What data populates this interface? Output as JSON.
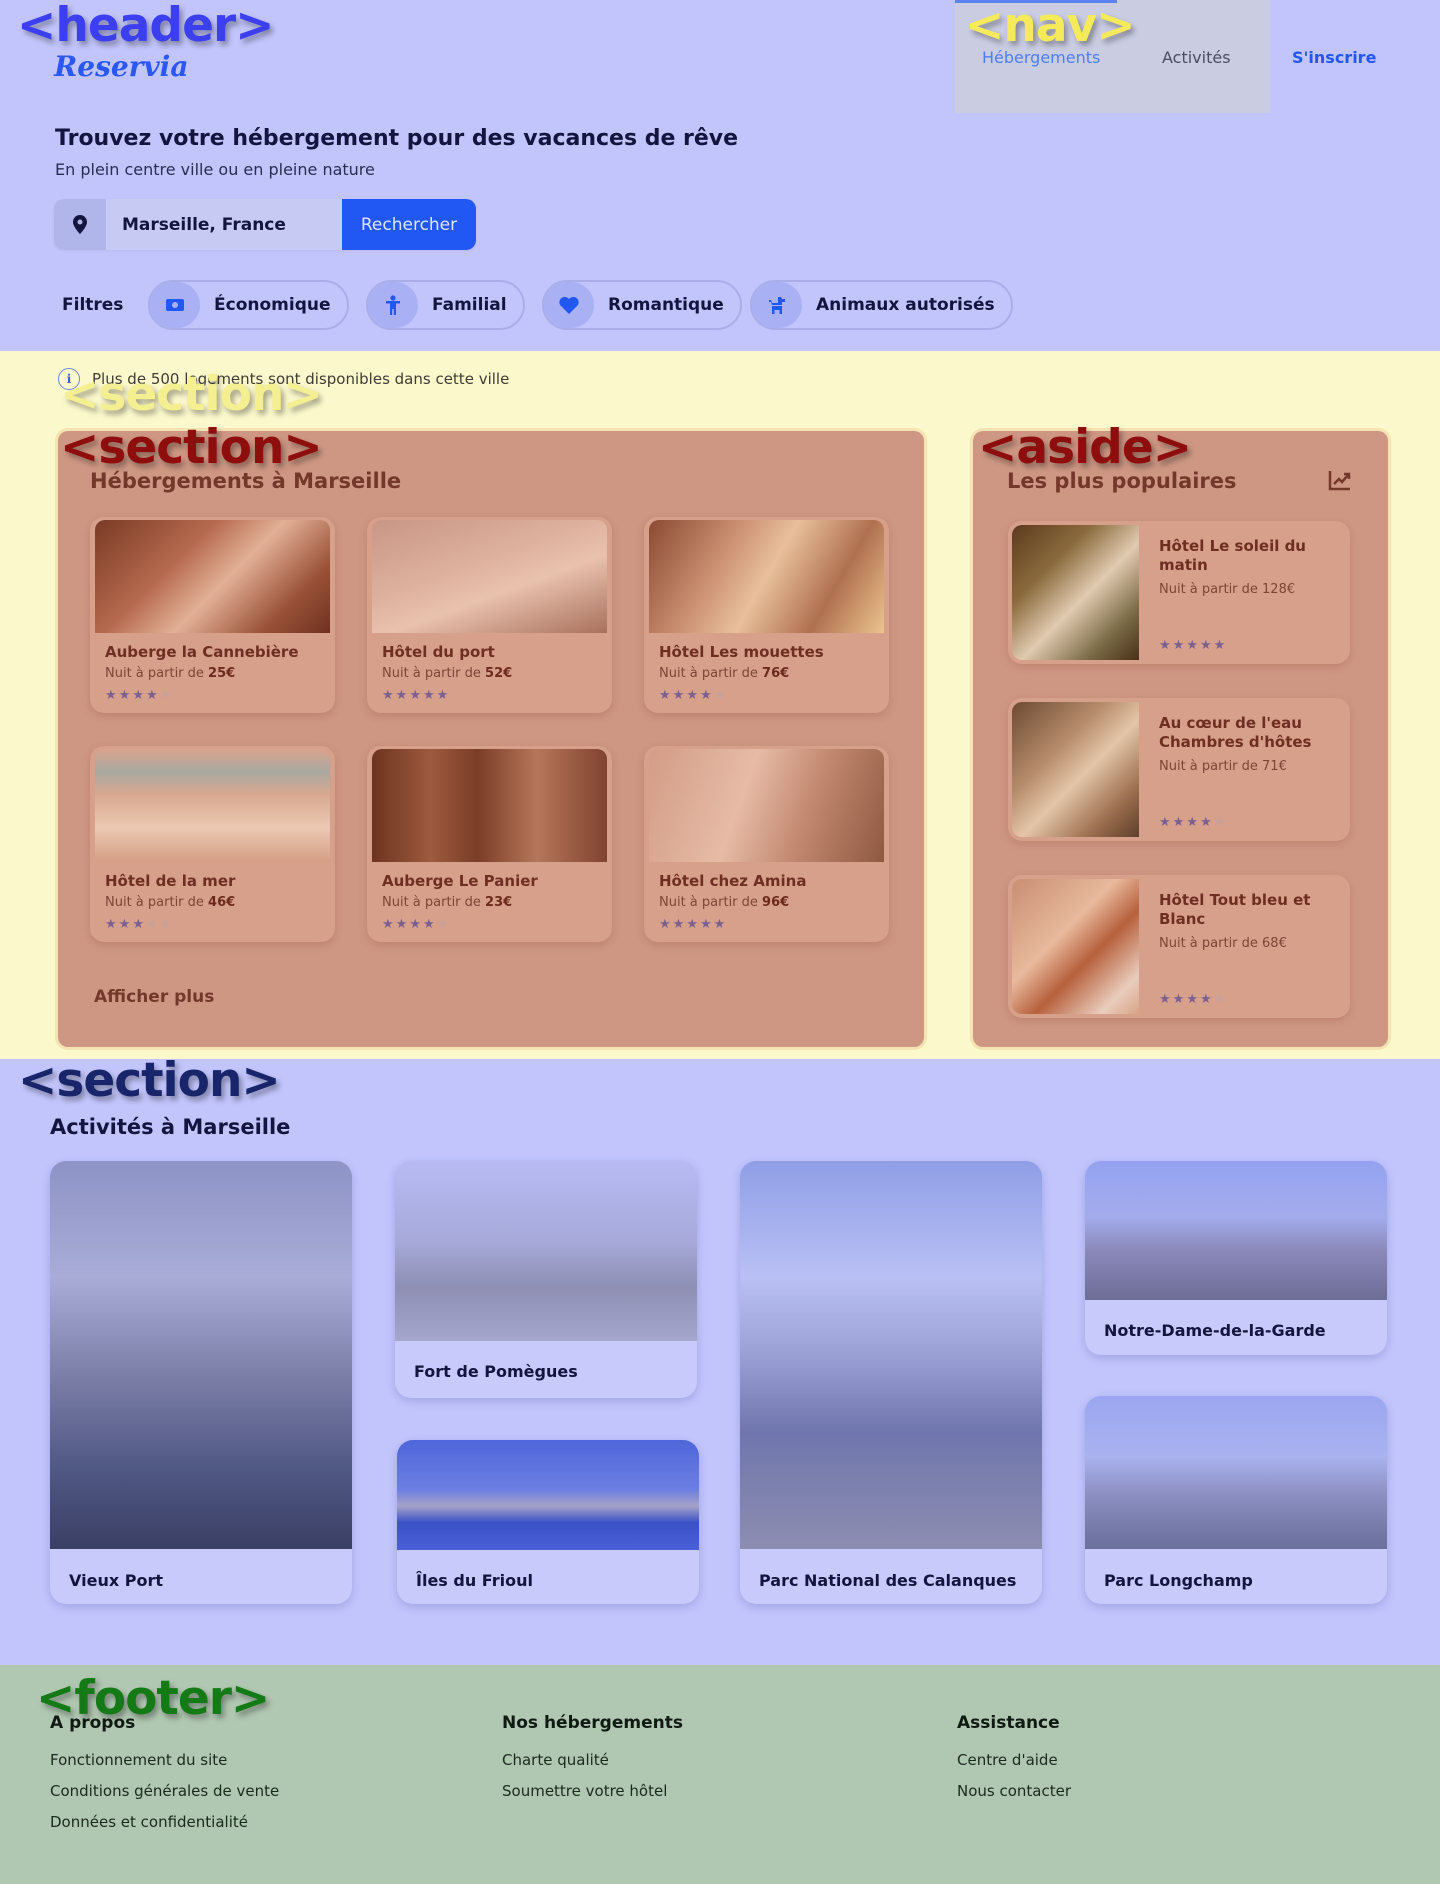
{
  "header": {
    "logo": "Reservia",
    "nav": {
      "hebergements": "Hébergements",
      "activites": "Activités"
    },
    "signup": "S'inscrire",
    "title": "Trouvez votre hébergement pour des vacances de rêve",
    "subtitle": "En plein centre ville ou en pleine nature",
    "search": {
      "value": "Marseille, France",
      "button": "Rechercher"
    },
    "filters_label": "Filtres",
    "filters": [
      "Économique",
      "Familial",
      "Romantique",
      "Animaux autorisés"
    ]
  },
  "main": {
    "info": "Plus de 500 logements sont disponibles dans cette ville",
    "accommodations": {
      "title": "Hébergements à Marseille",
      "price_prefix": "Nuit à partir de",
      "items": [
        {
          "name": "Auberge la Cannebière",
          "price": "25€",
          "rating": 4
        },
        {
          "name": "Hôtel du port",
          "price": "52€",
          "rating": 5
        },
        {
          "name": "Hôtel Les mouettes",
          "price": "76€",
          "rating": 4
        },
        {
          "name": "Hôtel de la mer",
          "price": "46€",
          "rating": 3
        },
        {
          "name": "Auberge Le Panier",
          "price": "23€",
          "rating": 4
        },
        {
          "name": "Hôtel chez Amina",
          "price": "96€",
          "rating": 5
        }
      ],
      "more": "Afficher plus"
    },
    "popular": {
      "title": "Les plus populaires",
      "items": [
        {
          "name": "Hôtel Le soleil du matin",
          "price": "Nuit à partir de 128€",
          "rating": 5
        },
        {
          "name": "Au cœur de l'eau Chambres d'hôtes",
          "price": "Nuit à partir de 71€",
          "rating": 4
        },
        {
          "name": "Hôtel Tout bleu et Blanc",
          "price": "Nuit à partir de 68€",
          "rating": 4
        }
      ]
    }
  },
  "activities": {
    "title": "Activités à Marseille",
    "items": [
      "Vieux Port",
      "Fort de Pomègues",
      "Îles du Frioul",
      "Parc National des Calanques",
      "Notre-Dame-de-la-Garde",
      "Parc Longchamp"
    ]
  },
  "footer": {
    "columns": [
      {
        "title": "A propos",
        "links": [
          "Fonctionnement du site",
          "Conditions générales de vente",
          "Données et confidentialité"
        ]
      },
      {
        "title": "Nos hébergements",
        "links": [
          "Charte qualité",
          "Soumettre votre hôtel"
        ]
      },
      {
        "title": "Assistance",
        "links": [
          "Centre d'aide",
          "Nous contacter"
        ]
      }
    ]
  },
  "annotations": {
    "header": "<header>",
    "nav": "<nav>",
    "section_info": "<section>",
    "section_main": "<section>",
    "aside": "<aside>",
    "section_acts": "<section>",
    "footer": "<footer>"
  },
  "colors": {
    "accent": "#2157f2",
    "header_bg": "#c2c5fc",
    "main_bg": "#fbf8cc",
    "panel": "#ce9783",
    "footer_bg": "#b0c7b1"
  },
  "icons": [
    "location-pin-icon",
    "money-icon",
    "child-icon",
    "heart-icon",
    "dog-icon",
    "info-icon",
    "trending-up-icon",
    "star-icon"
  ]
}
